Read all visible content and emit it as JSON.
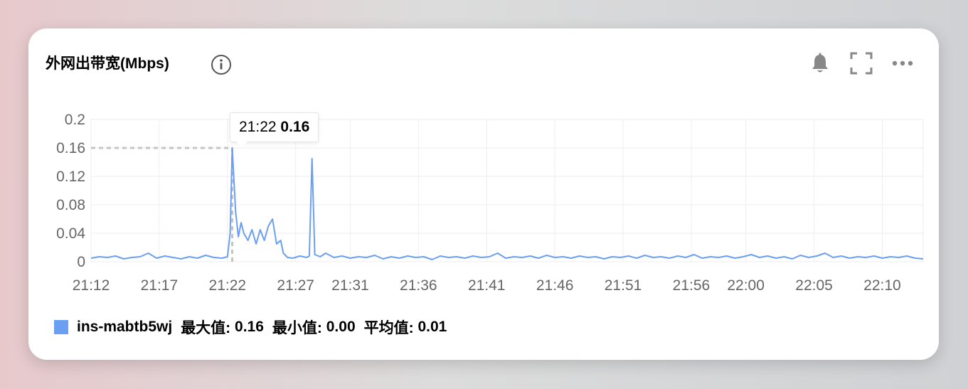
{
  "card": {
    "title": "外网出带宽(Mbps)",
    "icons": [
      "info-icon",
      "bell-icon",
      "fullscreen-icon",
      "more-icon"
    ]
  },
  "tooltip": {
    "time": "21:22",
    "value": "0.16"
  },
  "legend": {
    "series_name": "ins-mabtb5wj",
    "max_label": "最大值:",
    "max_value": "0.16",
    "min_label": "最小值:",
    "min_value": "0.00",
    "avg_label": "平均值:",
    "avg_value": "0.01"
  },
  "colors": {
    "series": "#6b9ff2",
    "grid": "#eeeeee",
    "axis_text": "#666666",
    "crosshair": "#c4c4c4"
  },
  "chart_data": {
    "type": "line",
    "title": "外网出带宽(Mbps)",
    "xlabel": "",
    "ylabel": "",
    "ylim": [
      0,
      0.2
    ],
    "yticks": [
      0,
      0.04,
      0.08,
      0.12,
      0.16,
      0.2
    ],
    "ytick_labels": [
      "0",
      "0.04",
      "0.08",
      "0.12",
      "0.16",
      "0.2"
    ],
    "xtick_labels": [
      "21:12",
      "21:17",
      "21:22",
      "21:27",
      "21:31",
      "21:36",
      "21:41",
      "21:46",
      "21:51",
      "21:56",
      "22:00",
      "22:05",
      "22:10"
    ],
    "xtick_minutes": [
      0,
      5,
      10,
      15,
      19,
      24,
      29,
      34,
      39,
      44,
      48,
      53,
      58
    ],
    "x_range_minutes": [
      0,
      61
    ],
    "grid": true,
    "legend_position": "bottom-left",
    "series": [
      {
        "name": "ins-mabtb5wj",
        "points": [
          [
            0,
            0.005
          ],
          [
            0.6,
            0.007
          ],
          [
            1.2,
            0.006
          ],
          [
            1.8,
            0.008
          ],
          [
            2.4,
            0.004
          ],
          [
            3.0,
            0.006
          ],
          [
            3.6,
            0.007
          ],
          [
            4.2,
            0.012
          ],
          [
            4.8,
            0.005
          ],
          [
            5.4,
            0.008
          ],
          [
            6.0,
            0.006
          ],
          [
            6.6,
            0.004
          ],
          [
            7.2,
            0.007
          ],
          [
            7.8,
            0.005
          ],
          [
            8.4,
            0.009
          ],
          [
            9.0,
            0.006
          ],
          [
            9.6,
            0.005
          ],
          [
            10.0,
            0.007
          ],
          [
            10.2,
            0.04
          ],
          [
            10.35,
            0.16
          ],
          [
            10.6,
            0.07
          ],
          [
            10.8,
            0.035
          ],
          [
            11.0,
            0.055
          ],
          [
            11.2,
            0.04
          ],
          [
            11.5,
            0.03
          ],
          [
            11.8,
            0.045
          ],
          [
            12.1,
            0.025
          ],
          [
            12.4,
            0.045
          ],
          [
            12.7,
            0.03
          ],
          [
            13.0,
            0.05
          ],
          [
            13.3,
            0.06
          ],
          [
            13.6,
            0.025
          ],
          [
            13.9,
            0.03
          ],
          [
            14.1,
            0.012
          ],
          [
            14.4,
            0.006
          ],
          [
            14.8,
            0.005
          ],
          [
            15.3,
            0.008
          ],
          [
            15.8,
            0.006
          ],
          [
            16.0,
            0.008
          ],
          [
            16.2,
            0.145
          ],
          [
            16.4,
            0.01
          ],
          [
            16.8,
            0.007
          ],
          [
            17.2,
            0.012
          ],
          [
            17.8,
            0.006
          ],
          [
            18.4,
            0.008
          ],
          [
            19.0,
            0.005
          ],
          [
            19.6,
            0.007
          ],
          [
            20.2,
            0.006
          ],
          [
            20.8,
            0.009
          ],
          [
            21.4,
            0.004
          ],
          [
            22.0,
            0.007
          ],
          [
            22.6,
            0.005
          ],
          [
            23.2,
            0.008
          ],
          [
            23.8,
            0.006
          ],
          [
            24.4,
            0.007
          ],
          [
            25.0,
            0.003
          ],
          [
            25.6,
            0.008
          ],
          [
            26.2,
            0.006
          ],
          [
            26.8,
            0.007
          ],
          [
            27.4,
            0.005
          ],
          [
            28.0,
            0.008
          ],
          [
            28.6,
            0.006
          ],
          [
            29.2,
            0.007
          ],
          [
            29.8,
            0.012
          ],
          [
            30.4,
            0.005
          ],
          [
            31.0,
            0.007
          ],
          [
            31.6,
            0.006
          ],
          [
            32.2,
            0.008
          ],
          [
            32.8,
            0.005
          ],
          [
            33.4,
            0.009
          ],
          [
            34.0,
            0.006
          ],
          [
            34.6,
            0.007
          ],
          [
            35.2,
            0.005
          ],
          [
            35.8,
            0.008
          ],
          [
            36.4,
            0.006
          ],
          [
            37.0,
            0.007
          ],
          [
            37.6,
            0.004
          ],
          [
            38.2,
            0.007
          ],
          [
            38.8,
            0.006
          ],
          [
            39.4,
            0.008
          ],
          [
            40.0,
            0.005
          ],
          [
            40.6,
            0.009
          ],
          [
            41.2,
            0.006
          ],
          [
            41.8,
            0.007
          ],
          [
            42.4,
            0.005
          ],
          [
            43.0,
            0.008
          ],
          [
            43.6,
            0.006
          ],
          [
            44.2,
            0.01
          ],
          [
            44.8,
            0.005
          ],
          [
            45.4,
            0.007
          ],
          [
            46.0,
            0.006
          ],
          [
            46.6,
            0.008
          ],
          [
            47.2,
            0.005
          ],
          [
            47.8,
            0.007
          ],
          [
            48.4,
            0.01
          ],
          [
            49.0,
            0.006
          ],
          [
            49.6,
            0.008
          ],
          [
            50.2,
            0.005
          ],
          [
            50.8,
            0.007
          ],
          [
            51.4,
            0.004
          ],
          [
            52.0,
            0.009
          ],
          [
            52.6,
            0.006
          ],
          [
            53.2,
            0.008
          ],
          [
            53.8,
            0.012
          ],
          [
            54.4,
            0.006
          ],
          [
            55.0,
            0.008
          ],
          [
            55.6,
            0.005
          ],
          [
            56.2,
            0.007
          ],
          [
            56.8,
            0.006
          ],
          [
            57.4,
            0.008
          ],
          [
            58.0,
            0.005
          ],
          [
            58.6,
            0.007
          ],
          [
            59.2,
            0.006
          ],
          [
            59.8,
            0.008
          ],
          [
            60.4,
            0.005
          ],
          [
            61.0,
            0.004
          ]
        ]
      }
    ],
    "highlight": {
      "x_label": "21:22",
      "x_minute": 10.35,
      "y": 0.16
    }
  }
}
